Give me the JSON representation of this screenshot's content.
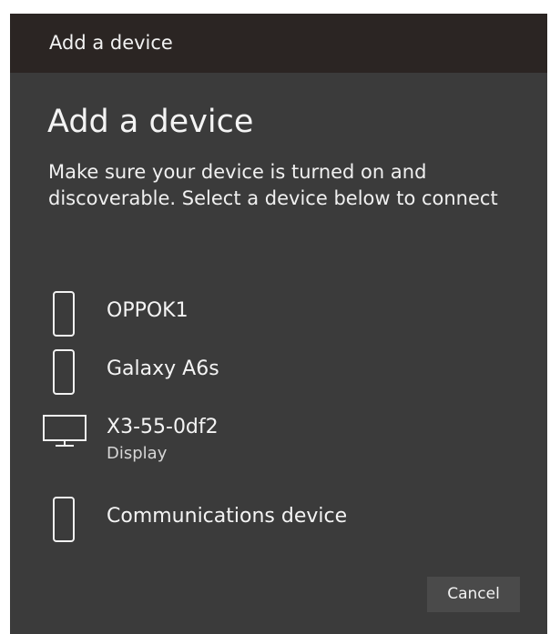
{
  "window": {
    "title": "Add a device"
  },
  "dialog": {
    "heading": "Add a device",
    "description": "Make sure your device is turned on and discoverable. Select a device below to connect"
  },
  "devices": [
    {
      "name": "OPPOK1",
      "subtitle": "",
      "icon": "phone-icon"
    },
    {
      "name": "Galaxy A6s",
      "subtitle": "",
      "icon": "phone-icon"
    },
    {
      "name": "X3-55-0df2",
      "subtitle": "Display",
      "icon": "monitor-icon"
    },
    {
      "name": "Communications device",
      "subtitle": "",
      "icon": "phone-icon"
    }
  ],
  "actions": {
    "cancel_label": "Cancel"
  },
  "colors": {
    "titlebar_bg": "#2b2523",
    "dialog_bg": "#3b3b3b",
    "button_bg": "#4a4a4a",
    "text": "#f4f4f4"
  }
}
